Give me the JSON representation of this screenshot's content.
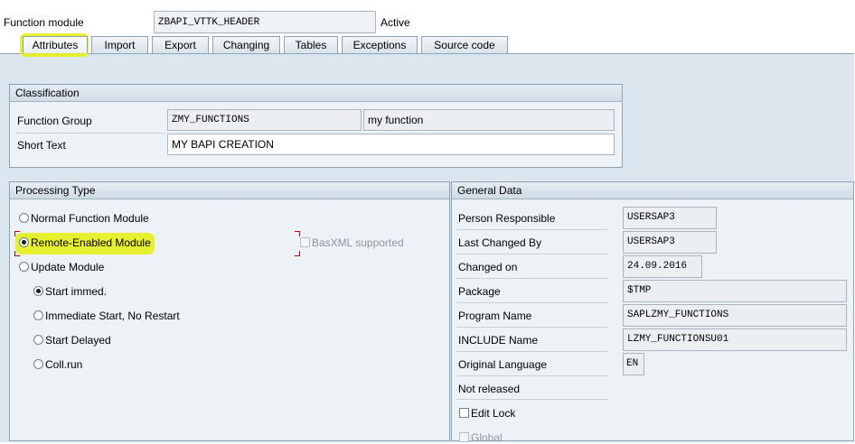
{
  "header": {
    "function_module_label": "Function module",
    "function_module_value": "ZBAPI_VTTK_HEADER",
    "status": "Active"
  },
  "tabs": [
    {
      "label": "Attributes",
      "active": true
    },
    {
      "label": "Import",
      "active": false
    },
    {
      "label": "Export",
      "active": false
    },
    {
      "label": "Changing",
      "active": false
    },
    {
      "label": "Tables",
      "active": false
    },
    {
      "label": "Exceptions",
      "active": false
    },
    {
      "label": "Source code",
      "active": false
    }
  ],
  "classification": {
    "title": "Classification",
    "function_group_label": "Function Group",
    "function_group_value": "ZMY_FUNCTIONS",
    "function_group_desc": "my function",
    "short_text_label": "Short Text",
    "short_text_value": "MY BAPI CREATION"
  },
  "processing_type": {
    "title": "Processing Type",
    "normal": "Normal Function Module",
    "remote": "Remote-Enabled Module",
    "basxml": "BasXML supported",
    "update": "Update Module",
    "start_immed": "Start immed.",
    "immediate_no_restart": "Immediate Start, No Restart",
    "start_delayed": "Start Delayed",
    "coll_run": "Coll.run",
    "selected": "remote",
    "update_selected": "start_immed"
  },
  "general_data": {
    "title": "General Data",
    "person_label": "Person Responsible",
    "person_value": "USERSAP3",
    "changed_by_label": "Last Changed By",
    "changed_by_value": "USERSAP3",
    "changed_on_label": "Changed on",
    "changed_on_value": "24.09.2016",
    "package_label": "Package",
    "package_value": "$TMP",
    "program_label": "Program Name",
    "program_value": "SAPLZMY_FUNCTIONS",
    "include_label": "INCLUDE Name",
    "include_value": "LZMY_FUNCTIONSU01",
    "language_label": "Original Language",
    "language_value": "EN",
    "release_status": "Not released",
    "edit_lock_label": "Edit Lock",
    "global_label": "Global"
  },
  "colors": {
    "highlight": "#e6f01a",
    "panel": "#dbe6ef",
    "group": "#edf2f7",
    "border": "#8ea2b5"
  }
}
